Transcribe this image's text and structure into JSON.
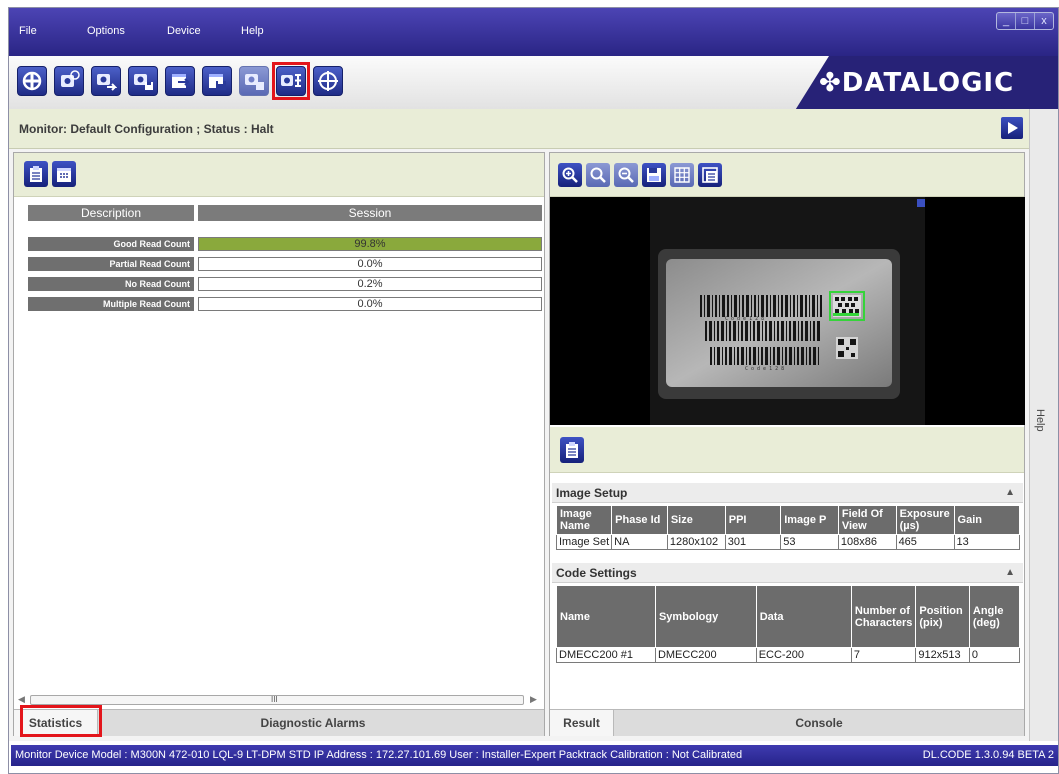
{
  "menu": [
    "File",
    "Options",
    "Device",
    "Help"
  ],
  "window_controls": [
    "_",
    "□",
    "x"
  ],
  "toolbar": {
    "buttons": [
      {
        "icon": "getting-started-icon"
      },
      {
        "icon": "open-device-config-icon"
      },
      {
        "icon": "save-to-device-icon"
      },
      {
        "icon": "save-config-icon"
      },
      {
        "icon": "export-icon"
      },
      {
        "icon": "save-to-file-icon"
      },
      {
        "icon": "image-setup-icon"
      },
      {
        "icon": "monitor-icon",
        "highlighted": true
      },
      {
        "icon": "target-icon"
      }
    ],
    "logo_text": "DATALOGIC"
  },
  "status": {
    "text": "Monitor:  Default Configuration  ;  Status :  Halt"
  },
  "help_panel": {
    "label": "Help"
  },
  "statistics": {
    "headers": {
      "description": "Description",
      "session": "Session"
    },
    "rows": [
      {
        "label": "Good Read Count",
        "value": "99.8%",
        "level": 0.998
      },
      {
        "label": "Partial Read Count",
        "value": "0.0%",
        "level": 0
      },
      {
        "label": "No Read Count",
        "value": "0.2%",
        "level": 0.002
      },
      {
        "label": "Multiple Read Count",
        "value": "0.0%",
        "level": 0
      }
    ],
    "scroll_grip": "III"
  },
  "left_tabs": [
    {
      "label": "Statistics",
      "active": true,
      "highlighted": true
    },
    {
      "label": "Diagnostic Alarms",
      "active": false
    }
  ],
  "image_viewer": {
    "tools": [
      "zoom-in-icon",
      "zoom-100-icon",
      "zoom-out-icon",
      "save-image-icon",
      "grid-icon",
      "overlay-icon"
    ],
    "barcode_caption_top": "C o d e   1 2 8",
    "barcode_caption_bottom": "C o d e   1 2 8"
  },
  "image_setup": {
    "title": "Image Setup",
    "columns": [
      "Image Name",
      "Phase Id",
      "Size",
      "PPI",
      "Image P",
      "Field Of View",
      "Exposure (µs)",
      "Gain"
    ],
    "rows": [
      [
        "Image Set",
        "NA",
        "1280x102",
        "301",
        "53",
        "108x86",
        "465",
        "13"
      ]
    ]
  },
  "code_settings": {
    "title": "Code Settings",
    "columns": [
      "Name",
      "Symbology",
      "Data",
      "Number of Characters",
      "Position (pix)",
      "Angle (deg)"
    ],
    "rows": [
      [
        "DMECC200  #1",
        "DMECC200",
        "ECC-200",
        "7",
        "912x513",
        "0"
      ]
    ]
  },
  "right_tabs": [
    {
      "label": "Result",
      "active": true
    },
    {
      "label": "Console",
      "active": false
    }
  ],
  "bottom_status": {
    "left": "Monitor   Device Model : M300N 472-010 LQL-9 LT-DPM STD   IP Address :  172.27.101.69   User : Installer-Expert   Packtrack Calibration : Not Calibrated",
    "right": "DL.CODE 1.3.0.94 BETA 2"
  }
}
